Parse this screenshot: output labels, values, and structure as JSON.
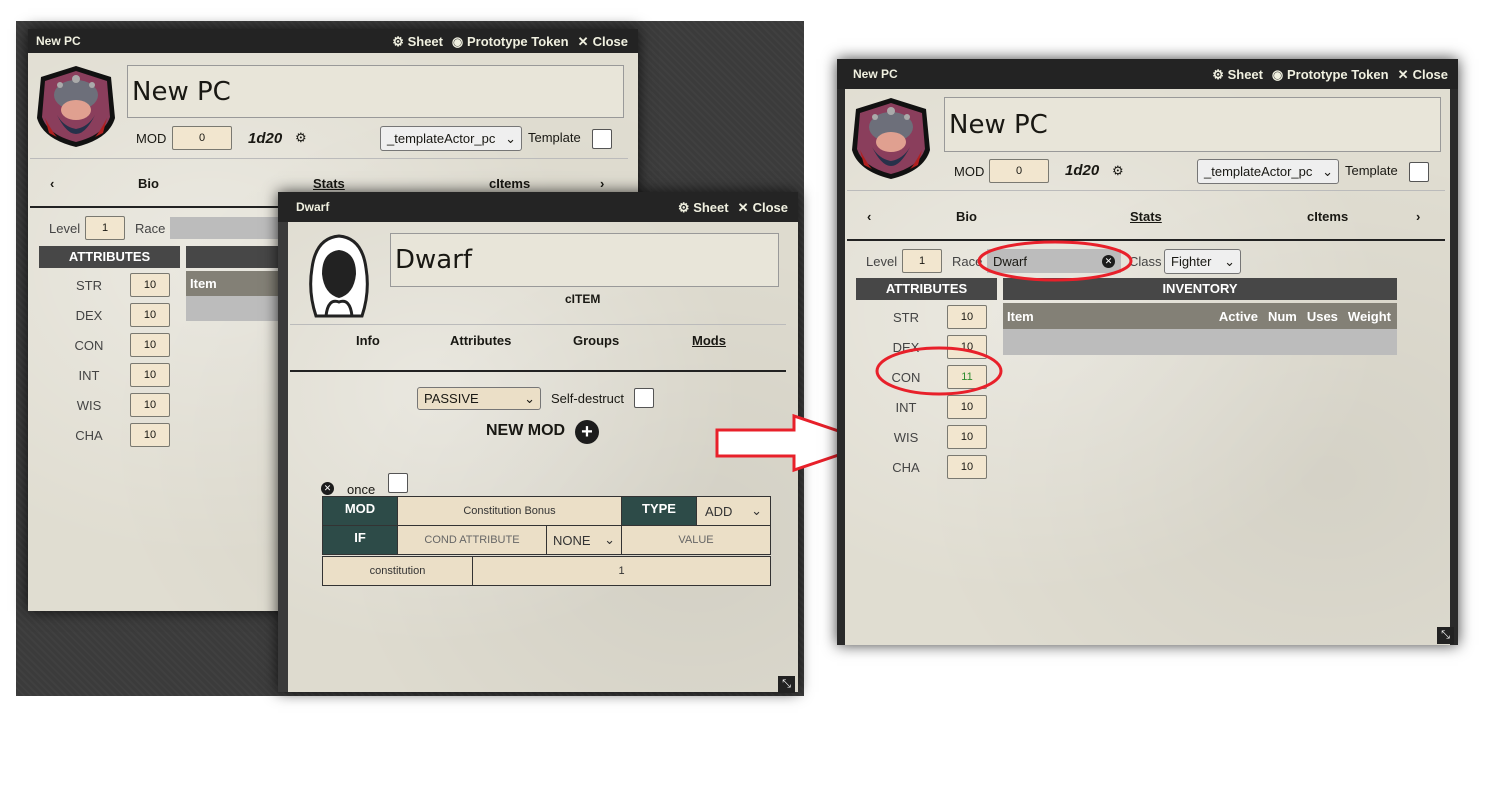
{
  "pc_back": {
    "title": "New PC",
    "sheet": "Sheet",
    "prototype": "Prototype Token",
    "close": "Close",
    "name": "New PC",
    "mod_label": "MOD",
    "mod_value": "0",
    "dice": "1d20",
    "template_select": "_templateActor_pc",
    "template_label": "Template",
    "tabs": [
      "Bio",
      "Stats",
      "cItems"
    ],
    "level_label": "Level",
    "level_value": "1",
    "race_label": "Race",
    "attributes_header": "ATTRIBUTES",
    "attributes": [
      {
        "name": "STR",
        "value": "10"
      },
      {
        "name": "DEX",
        "value": "10"
      },
      {
        "name": "CON",
        "value": "10"
      },
      {
        "name": "INT",
        "value": "10"
      },
      {
        "name": "WIS",
        "value": "10"
      },
      {
        "name": "CHA",
        "value": "10"
      }
    ],
    "item_col": "Item"
  },
  "item_window": {
    "title": "Dwarf",
    "sheet": "Sheet",
    "close": "Close",
    "name": "Dwarf",
    "type": "cITEM",
    "tabs": [
      "Info",
      "Attributes",
      "Groups",
      "Mods"
    ],
    "passive_select": "PASSIVE",
    "self_destruct": "Self-destruct",
    "new_mod": "NEW MOD",
    "once_label": "once",
    "mod_label": "MOD",
    "mod_name": "Constitution Bonus",
    "type_label": "TYPE",
    "type_value": "ADD",
    "if_label": "IF",
    "cond_attribute": "COND ATTRIBUTE",
    "cond_select": "NONE",
    "value_label": "VALUE",
    "attr_key": "constitution",
    "attr_value": "1"
  },
  "pc_front": {
    "title": "New PC",
    "sheet": "Sheet",
    "prototype": "Prototype Token",
    "close": "Close",
    "name": "New PC",
    "mod_label": "MOD",
    "mod_value": "0",
    "dice": "1d20",
    "template_select": "_templateActor_pc",
    "template_label": "Template",
    "tabs": [
      "Bio",
      "Stats",
      "cItems"
    ],
    "level_label": "Level",
    "level_value": "1",
    "race_label": "Race",
    "race_value": "Dwarf",
    "class_label": "Class",
    "class_value": "Fighter",
    "attributes_header": "ATTRIBUTES",
    "attributes": [
      {
        "name": "STR",
        "value": "10"
      },
      {
        "name": "DEX",
        "value": "10"
      },
      {
        "name": "CON",
        "value": "11"
      },
      {
        "name": "INT",
        "value": "10"
      },
      {
        "name": "WIS",
        "value": "10"
      },
      {
        "name": "CHA",
        "value": "10"
      }
    ],
    "inventory_header": "INVENTORY",
    "inventory_cols": [
      "Item",
      "Active",
      "Num",
      "Uses",
      "Weight"
    ]
  },
  "colors": {
    "accent_red": "#e8202a",
    "mod_cell": "#2d4b48",
    "bonus_green": "#2e8b2e"
  },
  "icons": [
    "gear-icon",
    "user-circle-icon",
    "close-icon",
    "dice-icon",
    "plus-circle-icon",
    "remove-icon",
    "resize-icon",
    "chevron-left-icon",
    "chevron-right-icon",
    "arrow-right-icon"
  ]
}
